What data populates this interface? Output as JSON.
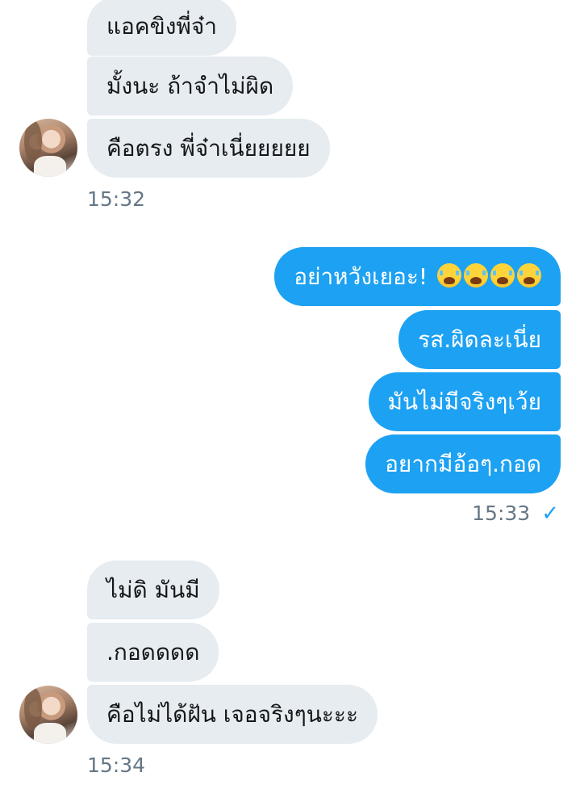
{
  "messages": {
    "incoming_1": [
      "แอคขิงพี่จ๋า",
      "มั้งนะ ถ้าจำไม่ผิด",
      "คือตรง พี่จ๋าเนี่ยยยยย"
    ],
    "incoming_1_time": "15:32",
    "outgoing_text_1": "อย่าหวังเยอะ!",
    "outgoing": [
      "รส.ผิดละเนี่ย",
      "มันไม่มีจริงๆเว้ย",
      "อยากมีอ้อๆ.กอด"
    ],
    "outgoing_time": "15:33",
    "incoming_2": [
      "ไม่ดิ มันมี",
      ".กอดดดด",
      "คือไม่ได้ฝัน เจอจริงๆนะะะ"
    ],
    "incoming_2_time": "15:34"
  },
  "icons": {
    "emoji": "loudly-crying-face",
    "read_receipt": "checkmark-icon",
    "check_glyph": "✓"
  },
  "colors": {
    "incoming_bubble": "#e6ecf0",
    "outgoing_bubble": "#1da1f2",
    "timestamp": "#657786"
  }
}
